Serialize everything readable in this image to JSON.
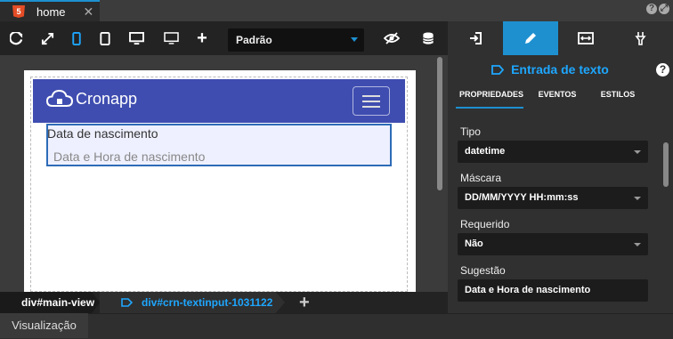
{
  "tabs": [
    {
      "label": "home",
      "close": "✕"
    }
  ],
  "window_icons": {
    "help": "?",
    "expand": "⤢"
  },
  "toolbar": {
    "buttons": [
      "refresh-icon",
      "fullscreen-icon",
      "mobile-icon",
      "tablet-icon",
      "desktop-icon",
      "monitor-icon",
      "add-icon"
    ],
    "size_select": "Padrão",
    "extra": [
      "hide-icon",
      "database-icon"
    ]
  },
  "canvas": {
    "brand": "Cronapp",
    "field_label": "Data de nascimento",
    "field_placeholder": "Data e Hora de nascimento"
  },
  "breadcrumb": {
    "items": [
      "div#main-view",
      "div#crn-textinput-1031122"
    ],
    "add": "+"
  },
  "status": {
    "tab": "Visualização"
  },
  "right_panel": {
    "title": "Entrada de texto",
    "help": "?",
    "subtabs": [
      "PROPRIEDADES",
      "EVENTOS",
      "ESTILOS"
    ],
    "properties": [
      {
        "label": "Tipo",
        "value": "datetime",
        "kind": "select"
      },
      {
        "label": "Máscara",
        "value": "DD/MM/YYYY HH:mm:ss",
        "kind": "select"
      },
      {
        "label": "Requerido",
        "value": "Não",
        "kind": "select"
      },
      {
        "label": "Sugestão",
        "value": "Data e Hora de nascimento",
        "kind": "text"
      }
    ]
  },
  "colors": {
    "accent": "#1e90d0",
    "navbar": "#3f4db0",
    "field_border": "#2d6bb7"
  }
}
